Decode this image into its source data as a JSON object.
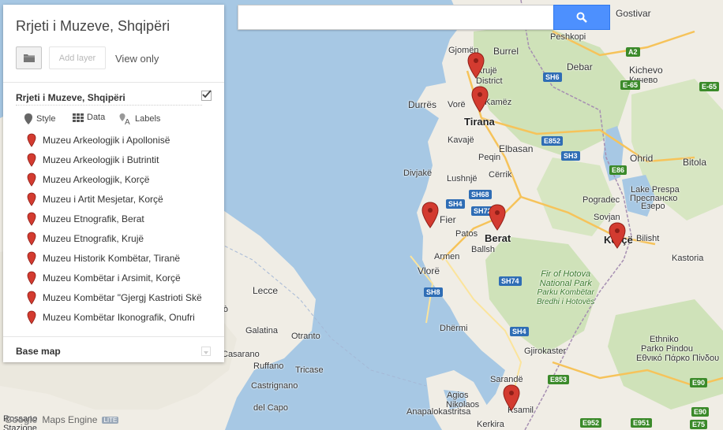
{
  "search": {
    "placeholder": ""
  },
  "panel": {
    "title": "Rrjeti i Muzeve, Shqipëri",
    "add_layer_label": "Add layer",
    "view_only_label": "View only",
    "layer_name": "Rrjeti i Muzeve, Shqipëri",
    "layer_visible": true,
    "tools": {
      "style": "Style",
      "data": "Data",
      "labels": "Labels"
    },
    "features": [
      "Muzeu Arkeologjik i Apollonisë",
      "Muzeu Arkeologjik i Butrintit",
      "Muzeu Arkeologjik, Korçë",
      "Muzeu i Artit Mesjetar, Korçë",
      "Muzeu Etnografik, Berat",
      "Muzeu Etnografik, Krujë",
      "Muzeu Historik Kombëtar, Tiranë",
      "Muzeu Kombëtar i Arsimit, Korçë",
      "Muzeu Kombëtar \"Gjergj Kastrioti Skë",
      "Muzeu Kombëtar Ikonografik, Onufri"
    ],
    "base_map_label": "Base map"
  },
  "branding": {
    "google": "Google",
    "product": "Maps Engine",
    "lite": "LITE"
  },
  "colors": {
    "water": "#a7c8e4",
    "land": "#f0ede5",
    "green": "#cfe2b9",
    "pin": "#d33b30",
    "search_button": "#4d90fe"
  },
  "map": {
    "places": [
      {
        "id": "gostivar",
        "label": "Gostivar"
      },
      {
        "id": "peshkopi",
        "label": "Peshkopi"
      },
      {
        "id": "debar",
        "label": "Debar"
      },
      {
        "id": "kichevo",
        "label": "Kichevo"
      },
      {
        "id": "kichevo-cyr",
        "label": "Кичево"
      },
      {
        "id": "gjomen",
        "label": "Gjomën"
      },
      {
        "id": "burrel",
        "label": "Burrel"
      },
      {
        "id": "kruje",
        "label": "Krujë"
      },
      {
        "id": "district",
        "label": "District"
      },
      {
        "id": "durres",
        "label": "Durrës"
      },
      {
        "id": "vore",
        "label": "Vorë"
      },
      {
        "id": "kamez",
        "label": "Kamëz"
      },
      {
        "id": "tirana",
        "label": "Tirana"
      },
      {
        "id": "kavaje",
        "label": "Kavajë"
      },
      {
        "id": "elbasan",
        "label": "Elbasan"
      },
      {
        "id": "peqin",
        "label": "Peqin"
      },
      {
        "id": "divjake",
        "label": "Divjakë"
      },
      {
        "id": "cerrik",
        "label": "Cërrik"
      },
      {
        "id": "ohrid",
        "label": "Ohrid"
      },
      {
        "id": "bitola",
        "label": "Bitola"
      },
      {
        "id": "lushnje",
        "label": "Lushnjë"
      },
      {
        "id": "lake-prespa",
        "label": "Lake Prespa"
      },
      {
        "id": "lake-prespa-cyr",
        "label": "Преспанско"
      },
      {
        "id": "lake-prespa-cyr2",
        "label": "Езеро"
      },
      {
        "id": "pogradec",
        "label": "Pogradec"
      },
      {
        "id": "fier",
        "label": "Fier"
      },
      {
        "id": "berat",
        "label": "Berat"
      },
      {
        "id": "sovjan",
        "label": "Sovjan"
      },
      {
        "id": "patos",
        "label": "Patos"
      },
      {
        "id": "korce",
        "label": "Korçë"
      },
      {
        "id": "bilisht",
        "label": "Bilisht"
      },
      {
        "id": "ballsh",
        "label": "Ballsh"
      },
      {
        "id": "armen",
        "label": "Armen"
      },
      {
        "id": "kastoria",
        "label": "Kastoria"
      },
      {
        "id": "vlore",
        "label": "Vlorë"
      },
      {
        "id": "lecce",
        "label": "Lecce"
      },
      {
        "id": "nardo",
        "label": "Nardò"
      },
      {
        "id": "galatina",
        "label": "Galatina"
      },
      {
        "id": "otranto",
        "label": "Otranto"
      },
      {
        "id": "dhermi",
        "label": "Dhërmi"
      },
      {
        "id": "gjirokaster",
        "label": "Gjirokaster"
      },
      {
        "id": "casarano",
        "label": "Casarano"
      },
      {
        "id": "ruffano",
        "label": "Ruffano"
      },
      {
        "id": "tricase",
        "label": "Tricase"
      },
      {
        "id": "ethniko",
        "label": "Ethniko"
      },
      {
        "id": "parko-pindou",
        "label": "Parko Pindou"
      },
      {
        "id": "parko-pindou-gr",
        "label": "Εθνικό Πάρκο Πίνδου"
      },
      {
        "id": "sarande",
        "label": "Sarandë"
      },
      {
        "id": "castrignano",
        "label": "Castrignano"
      },
      {
        "id": "del-capo",
        "label": "del Capo"
      },
      {
        "id": "agios",
        "label": "Agios"
      },
      {
        "id": "nikolaos",
        "label": "Nikolaos"
      },
      {
        "id": "ksamil",
        "label": "Ksamil"
      },
      {
        "id": "anapalokastritsa",
        "label": "Anapalokastritsa"
      },
      {
        "id": "kerkira",
        "label": "Kerkira"
      },
      {
        "id": "rossano",
        "label": "Rossano"
      },
      {
        "id": "stazione",
        "label": "Stazione"
      }
    ],
    "park_label": [
      "Fir of Hotova",
      "National Park",
      "Parku Kombëtar",
      "Bredhi i Hotovës"
    ],
    "roads": [
      "A2",
      "E-65",
      "E-65",
      "SH6",
      "E852",
      "SH3",
      "E86",
      "SH68",
      "SH4",
      "SH72",
      "SH74",
      "SH8",
      "SH4",
      "E853",
      "E90",
      "E90",
      "E952",
      "E951",
      "E75"
    ]
  }
}
